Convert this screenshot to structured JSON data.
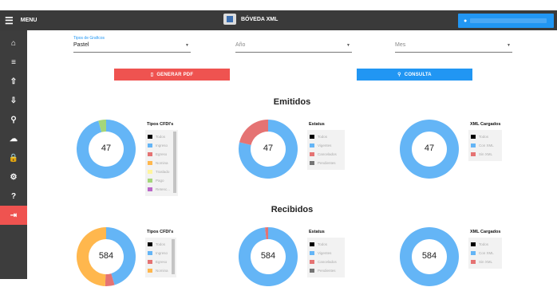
{
  "topbar": {
    "menu_label": "MENU",
    "app_title": "BÓVEDA XML",
    "user_name": ""
  },
  "sidebar": {
    "items": [
      {
        "icon": "home-icon",
        "glyph": "⌂"
      },
      {
        "icon": "list-icon",
        "glyph": "≡"
      },
      {
        "icon": "upload-icon",
        "glyph": "⇧"
      },
      {
        "icon": "download-icon",
        "glyph": "⇩"
      },
      {
        "icon": "search-icon",
        "glyph": "⚲"
      },
      {
        "icon": "cloud-icon",
        "glyph": "☁"
      },
      {
        "icon": "lock-icon",
        "glyph": "🔒"
      },
      {
        "icon": "gear-icon",
        "glyph": "⚙"
      },
      {
        "icon": "help-icon",
        "glyph": "?"
      },
      {
        "icon": "logout-icon",
        "glyph": "⇥"
      }
    ]
  },
  "filters": {
    "tipo": {
      "label": "Tipos de Graficos",
      "value": "Pastel"
    },
    "anio": {
      "placeholder": "Año"
    },
    "mes": {
      "placeholder": "Mes"
    }
  },
  "buttons": {
    "pdf": "GENERAR PDF",
    "consulta": "CONSULTA"
  },
  "colors": {
    "blue": "#64b5f6",
    "red": "#e57373",
    "orange": "#ffb74d",
    "green": "#a5d67a",
    "gray": "#757575",
    "black": "#000000"
  },
  "sections": {
    "emitidos": {
      "title": "Emitidos",
      "charts": [
        {
          "legend_title": "Tipos CFDI's",
          "total": "47",
          "legend": [
            {
              "label": "Todos",
              "color": "#000000"
            },
            {
              "label": "Ingreso",
              "color": "#64b5f6"
            },
            {
              "label": "Egreso",
              "color": "#e57373"
            },
            {
              "label": "Nomina",
              "color": "#ffb74d"
            },
            {
              "label": "Traslado",
              "color": "#fff59d"
            },
            {
              "label": "Pago",
              "color": "#a5d67a"
            },
            {
              "label": "Retenc...",
              "color": "#ba68c8"
            }
          ],
          "slices": [
            {
              "value": 45,
              "color": "#64b5f6"
            },
            {
              "value": 2,
              "color": "#a5d67a"
            }
          ]
        },
        {
          "legend_title": "Estatus",
          "total": "47",
          "legend": [
            {
              "label": "Todos",
              "color": "#000000"
            },
            {
              "label": "Vigentes",
              "color": "#64b5f6"
            },
            {
              "label": "Cancelados",
              "color": "#e57373"
            },
            {
              "label": "Pendientes",
              "color": "#757575"
            }
          ],
          "slices": [
            {
              "value": 37,
              "color": "#64b5f6"
            },
            {
              "value": 10,
              "color": "#e57373"
            }
          ]
        },
        {
          "legend_title": "XML Cargados",
          "total": "47",
          "legend": [
            {
              "label": "Todos",
              "color": "#000000"
            },
            {
              "label": "Con XML",
              "color": "#64b5f6"
            },
            {
              "label": "Sin XML",
              "color": "#e57373"
            }
          ],
          "slices": [
            {
              "value": 47,
              "color": "#64b5f6"
            }
          ]
        }
      ]
    },
    "recibidos": {
      "title": "Recibidos",
      "charts": [
        {
          "legend_title": "Tipos CFDI's",
          "total": "584",
          "legend": [
            {
              "label": "Todos",
              "color": "#000000"
            },
            {
              "label": "Ingreso",
              "color": "#64b5f6"
            },
            {
              "label": "Egreso",
              "color": "#e57373"
            },
            {
              "label": "Nomina",
              "color": "#ffb74d"
            }
          ],
          "slices": [
            {
              "value": 265,
              "color": "#64b5f6"
            },
            {
              "value": 30,
              "color": "#e57373"
            },
            {
              "value": 289,
              "color": "#ffb74d"
            }
          ]
        },
        {
          "legend_title": "Estatus",
          "total": "584",
          "legend": [
            {
              "label": "Todos",
              "color": "#000000"
            },
            {
              "label": "Vigentes",
              "color": "#64b5f6"
            },
            {
              "label": "Cancelados",
              "color": "#e57373"
            },
            {
              "label": "Pendientes",
              "color": "#757575"
            }
          ],
          "slices": [
            {
              "value": 574,
              "color": "#64b5f6"
            },
            {
              "value": 10,
              "color": "#e57373"
            }
          ]
        },
        {
          "legend_title": "XML Cargados",
          "total": "584",
          "legend": [
            {
              "label": "Todos",
              "color": "#000000"
            },
            {
              "label": "Con XML",
              "color": "#64b5f6"
            },
            {
              "label": "Sin XML",
              "color": "#e57373"
            }
          ],
          "slices": [
            {
              "value": 584,
              "color": "#64b5f6"
            }
          ]
        }
      ]
    }
  }
}
